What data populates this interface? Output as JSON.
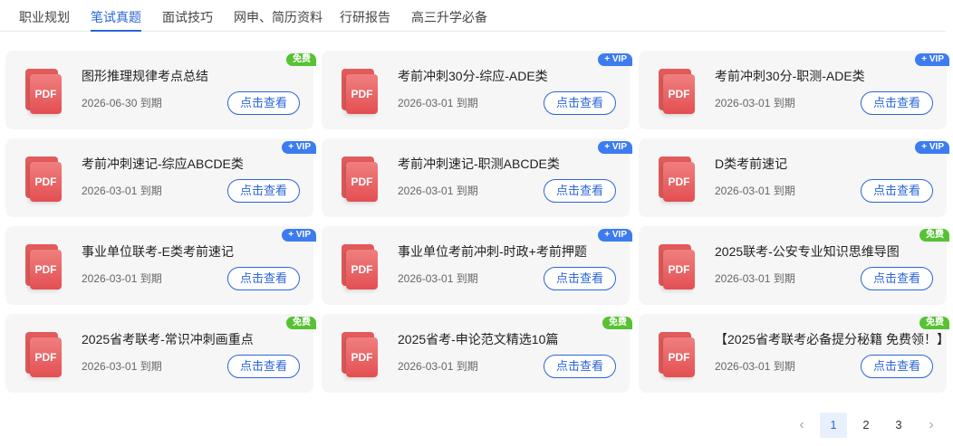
{
  "tabs": [
    {
      "label": "职业规划",
      "active": false
    },
    {
      "label": "笔试真题",
      "active": true
    },
    {
      "label": "面试技巧",
      "active": false
    },
    {
      "label": "网申、简历资料",
      "active": false
    },
    {
      "label": "行研报告",
      "active": false
    },
    {
      "label": "高三升学必备",
      "active": false
    }
  ],
  "file_icon_label": "PDF",
  "view_button_label": "点击查看",
  "badges": {
    "vip": "+ VIP",
    "free": "免费"
  },
  "cards": [
    {
      "title": "图形推理规律考点总结",
      "date": "2026-06-30 到期",
      "badge": "free"
    },
    {
      "title": "考前冲刺30分-综应-ADE类",
      "date": "2026-03-01 到期",
      "badge": "vip"
    },
    {
      "title": "考前冲刺30分-职测-ADE类",
      "date": "2026-03-01 到期",
      "badge": "vip"
    },
    {
      "title": "考前冲刺速记-综应ABCDE类",
      "date": "2026-03-01 到期",
      "badge": "vip"
    },
    {
      "title": "考前冲刺速记-职测ABCDE类",
      "date": "2026-03-01 到期",
      "badge": "vip"
    },
    {
      "title": "D类考前速记",
      "date": "2026-03-01 到期",
      "badge": "vip"
    },
    {
      "title": "事业单位联考-E类考前速记",
      "date": "2026-03-01 到期",
      "badge": "vip"
    },
    {
      "title": "事业单位考前冲刺-时政+考前押题",
      "date": "2026-03-01 到期",
      "badge": "vip"
    },
    {
      "title": "2025联考-公安专业知识思维导图",
      "date": "2026-03-01 到期",
      "badge": "free"
    },
    {
      "title": "2025省考联考-常识冲刺画重点",
      "date": "2026-03-01 到期",
      "badge": "free"
    },
    {
      "title": "2025省考-申论范文精选10篇",
      "date": "2026-03-01 到期",
      "badge": "free"
    },
    {
      "title": "【2025省考联考必备提分秘籍 免费领！】",
      "date": "2026-03-01 到期",
      "badge": "free"
    }
  ],
  "pagination": {
    "pages": [
      "1",
      "2",
      "3"
    ],
    "current": "1",
    "prev": "‹",
    "next": "›"
  }
}
